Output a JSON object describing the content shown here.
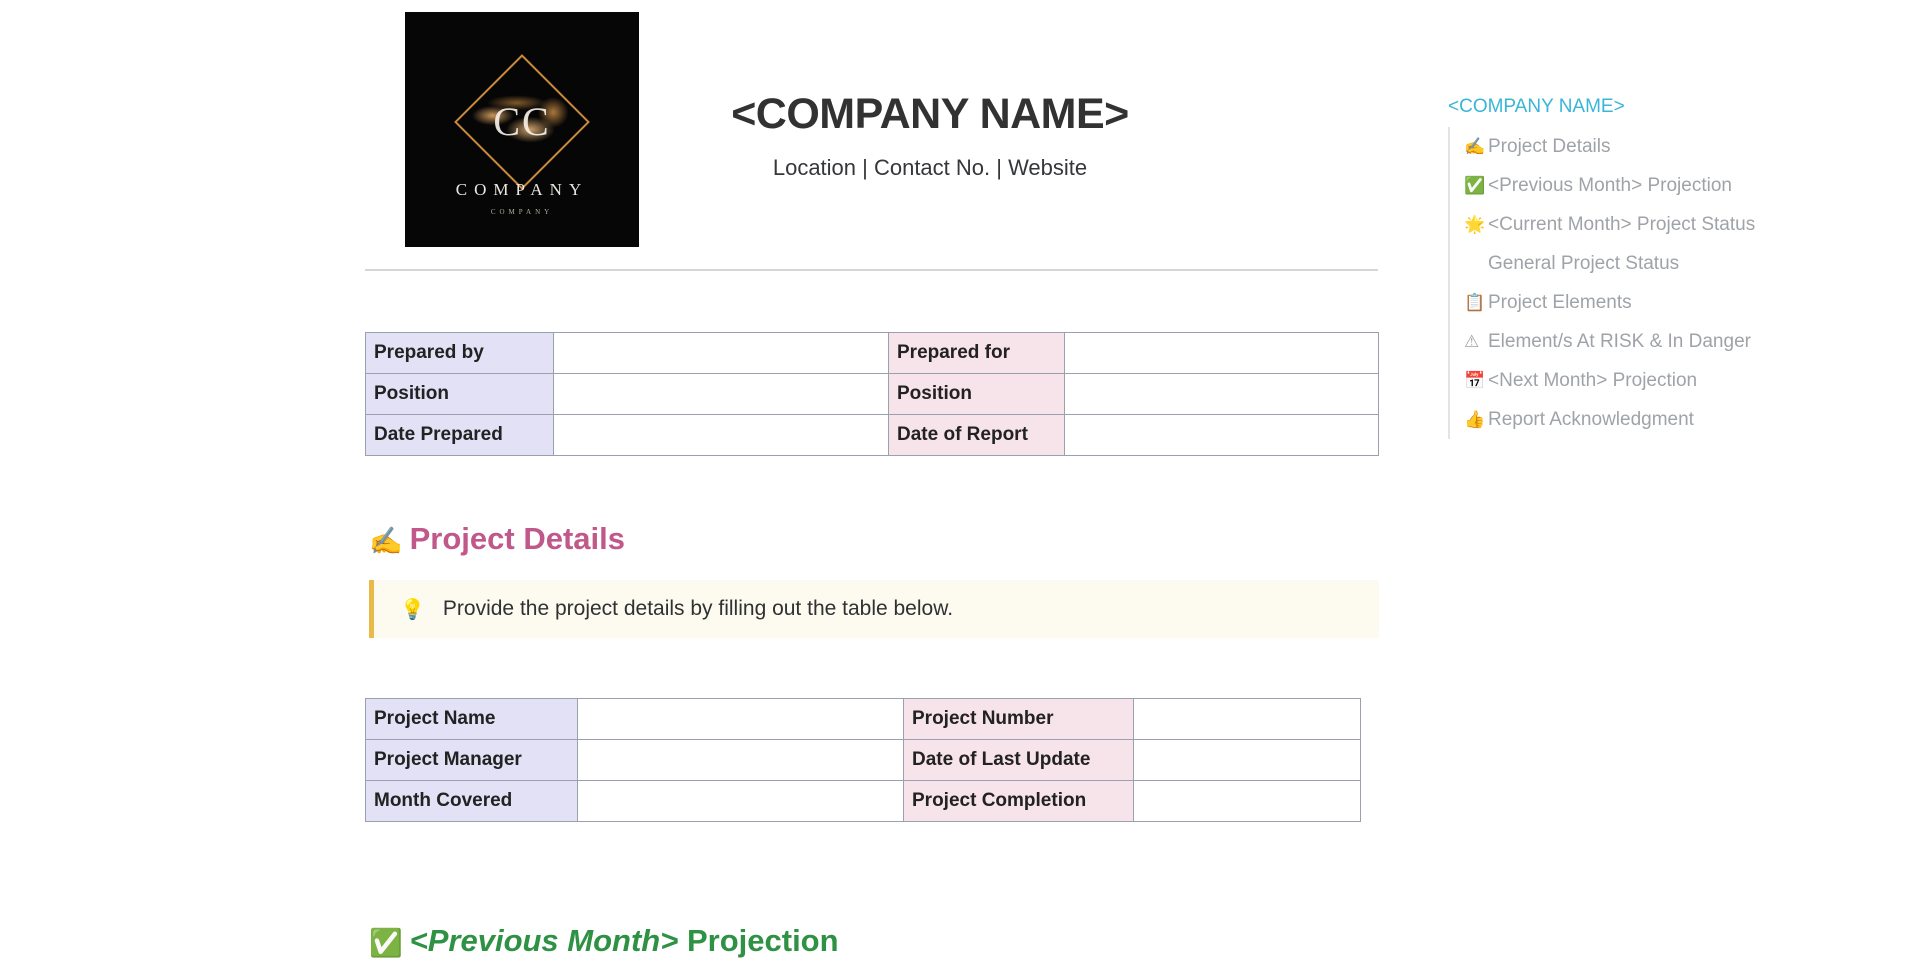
{
  "header": {
    "company_name": "<COMPANY NAME>",
    "company_meta": "Location | Contact No. | Website",
    "logo": {
      "monogram": "CC",
      "wordmark": "COMPANY",
      "subtext": "COMPANY"
    }
  },
  "prepared_table": {
    "rows": [
      {
        "left_label": "Prepared by",
        "left_value": "",
        "right_label": "Prepared for",
        "right_value": ""
      },
      {
        "left_label": "Position",
        "left_value": "",
        "right_label": "Position",
        "right_value": ""
      },
      {
        "left_label": "Date Prepared",
        "left_value": "",
        "right_label": "Date of Report",
        "right_value": ""
      }
    ]
  },
  "project_details": {
    "heading_icon": "✍️",
    "heading": "Project Details",
    "callout_icon": "💡",
    "callout_text": "Provide the project details by filling out the table below.",
    "rows": [
      {
        "left_label": "Project Name",
        "left_value": "",
        "right_label": "Project Number",
        "right_value": ""
      },
      {
        "left_label": "Project Manager",
        "left_value": "",
        "right_label": "Date of Last Update",
        "right_value": ""
      },
      {
        "left_label": "Month Covered",
        "left_value": "",
        "right_label": "Project Completion",
        "right_value": ""
      }
    ]
  },
  "previous_month_section": {
    "heading_icon": "✅",
    "heading_italic": "<Previous Month>",
    "heading_rest": " Projection"
  },
  "toc": {
    "title": "<COMPANY NAME>",
    "items": [
      {
        "icon": "✍️",
        "label": "Project Details"
      },
      {
        "icon": "✅",
        "label": "<Previous Month> Projection"
      },
      {
        "icon": "🌟",
        "label": "<Current Month> Project Status"
      },
      {
        "icon": "",
        "label": "General Project Status"
      },
      {
        "icon": "📋",
        "label": "Project Elements"
      },
      {
        "icon": "⚠",
        "label": "Element/s At RISK & In Danger"
      },
      {
        "icon": "📅",
        "label": "<Next Month> Projection"
      },
      {
        "icon": "👍",
        "label": "Report Acknowledgment"
      }
    ]
  },
  "colors": {
    "accent_teal": "#38b6d8",
    "heading_pink": "#c1588a",
    "heading_green": "#2f9144",
    "label_lavender": "#e3e1f5",
    "label_pink": "#f7e3ea",
    "callout_bg": "#fdfaef",
    "callout_border": "#e9b949",
    "table_border": "#9aa0ac"
  }
}
